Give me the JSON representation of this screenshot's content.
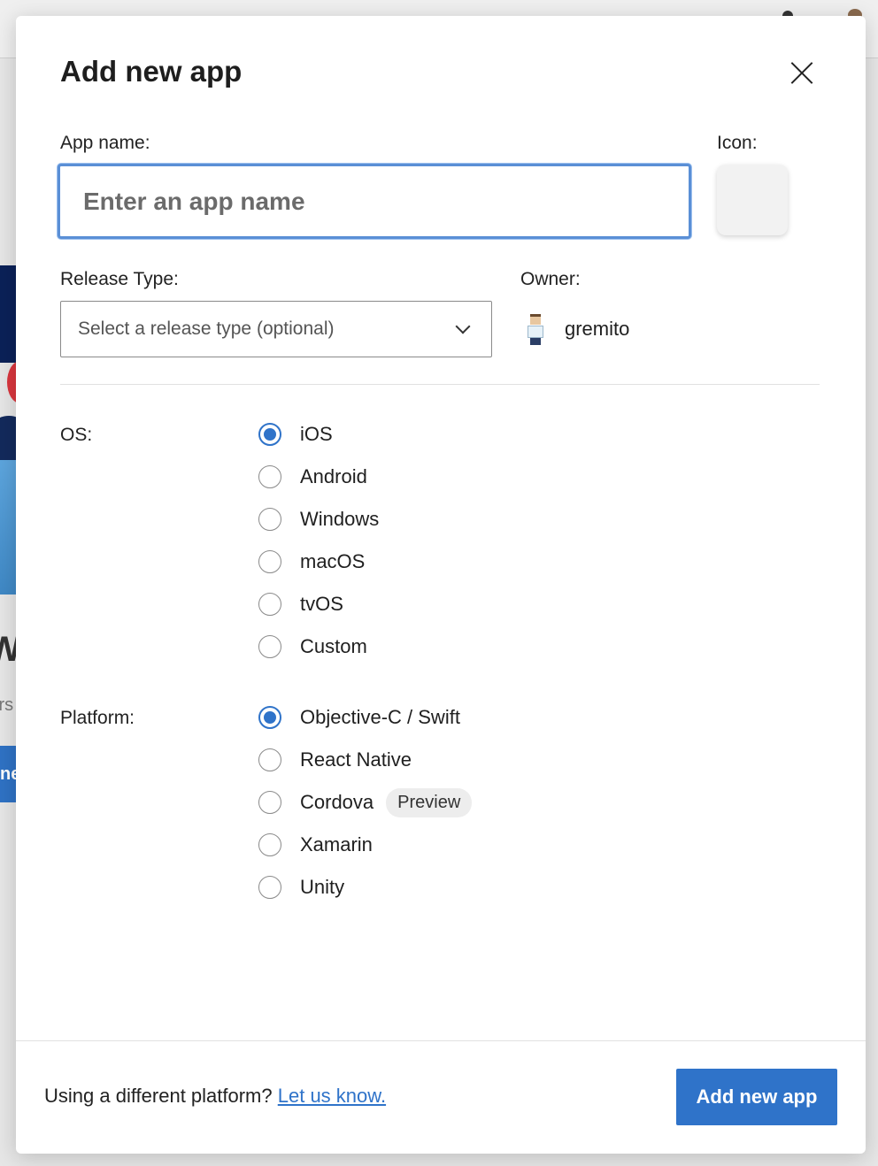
{
  "modal": {
    "title": "Add new app",
    "app_name": {
      "label": "App name:",
      "placeholder": "Enter an app name",
      "value": ""
    },
    "icon": {
      "label": "Icon:"
    },
    "release_type": {
      "label": "Release Type:",
      "placeholder": "Select a release type (optional)"
    },
    "owner": {
      "label": "Owner:",
      "name": "gremito"
    },
    "os": {
      "label": "OS:",
      "options": [
        "iOS",
        "Android",
        "Windows",
        "macOS",
        "tvOS",
        "Custom"
      ],
      "selected": "iOS"
    },
    "platform": {
      "label": "Platform:",
      "options": [
        "Objective-C / Swift",
        "React Native",
        "Cordova",
        "Xamarin",
        "Unity"
      ],
      "selected": "Objective-C / Swift",
      "badge": "Preview"
    },
    "footer": {
      "prompt": "Using a different platform?",
      "link": "Let us know.",
      "submit": "Add new app"
    }
  },
  "background": {
    "hero_partial": "We",
    "sub_partial": "irs",
    "button_partial": "ne"
  },
  "colors": {
    "accent": "#2f73c9",
    "focus_border": "#5a8fd6"
  }
}
